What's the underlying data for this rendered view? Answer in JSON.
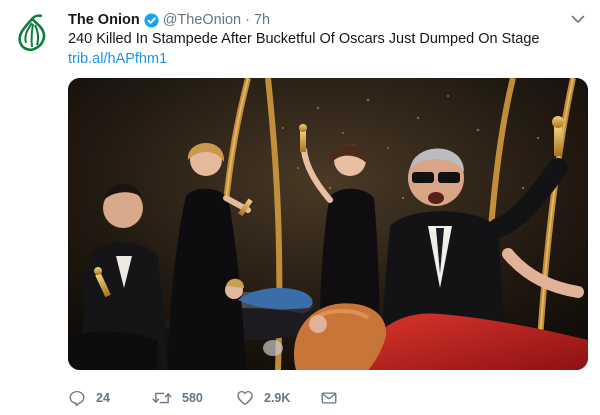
{
  "tweet": {
    "display_name": "The Onion",
    "handle": "@TheOnion",
    "separator": "·",
    "time": "7h",
    "text": "240 Killed In Stampede After Bucketful Of Oscars Just Dumped On Stage",
    "link": "trib.al/hAPfhm1"
  },
  "actions": {
    "reply_count": "24",
    "retweet_count": "580",
    "like_count": "2.9K"
  },
  "colors": {
    "onion_green": "#0f7d3c",
    "verified_blue": "#1da1f2",
    "link_blue": "#1b95e0",
    "muted_gray": "#657786"
  },
  "icons": {
    "avatar": "onion-logo-icon",
    "verified": "verified-badge-icon",
    "caret": "chevron-down-icon",
    "reply": "reply-icon",
    "retweet": "retweet-icon",
    "like": "heart-icon",
    "message": "mail-icon"
  }
}
